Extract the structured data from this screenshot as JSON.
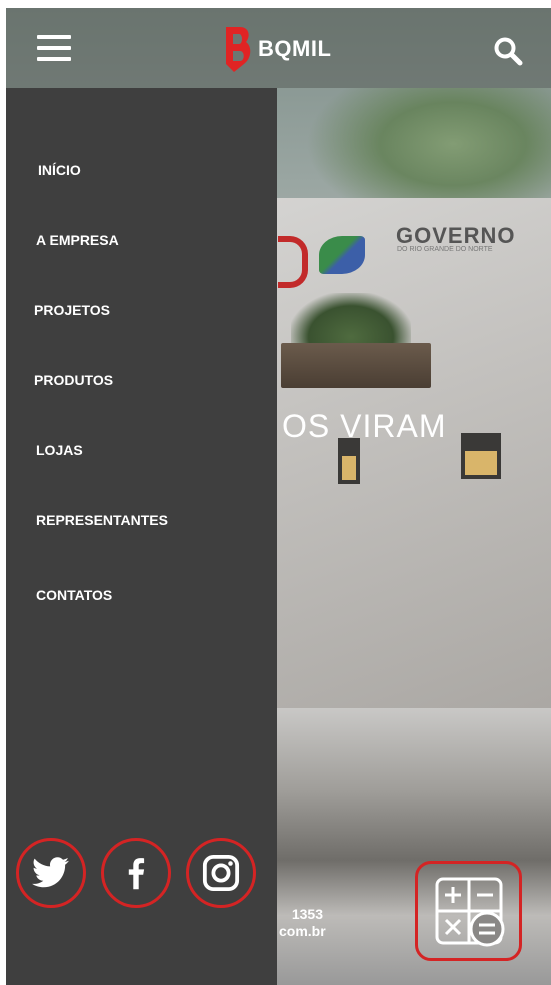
{
  "header": {
    "brand_name": "BQMIL",
    "menu_icon": "hamburger-menu-icon",
    "search_icon": "search-icon"
  },
  "drawer": {
    "items": [
      {
        "label": "INÍCIO"
      },
      {
        "label": "A EMPRESA"
      },
      {
        "label": "PROJETOS"
      },
      {
        "label": "PRODUTOS"
      },
      {
        "label": "LOJAS"
      },
      {
        "label": "REPRESENTANTES"
      },
      {
        "label": "CONTATOS"
      }
    ],
    "social": [
      {
        "icon": "twitter-icon"
      },
      {
        "icon": "facebook-icon"
      },
      {
        "icon": "instagram-icon"
      }
    ]
  },
  "hero": {
    "headline_visible": "OS VIRAM",
    "sign_text": "GOVERNO",
    "sign_subtext": "DO RIO GRANDE DO NORTE",
    "contact_line1": "1353",
    "contact_line2": "com.br"
  },
  "calculator_button": {
    "icon": "calculator-icon"
  },
  "colors": {
    "drawer_bg": "#3f3f3f",
    "accent": "#d42424",
    "text": "#ffffff"
  }
}
